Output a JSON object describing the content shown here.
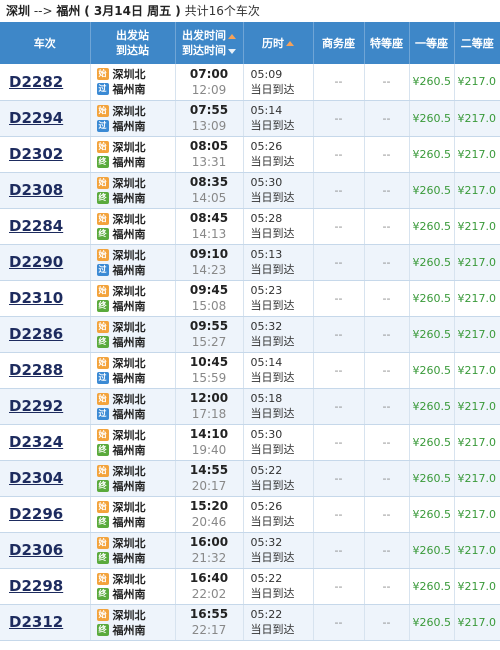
{
  "route": {
    "from": "深圳",
    "arrow": "-->",
    "to": "福州",
    "date": "( 3月14日  周五 )",
    "count": "共计16个车次"
  },
  "headers": {
    "train": "车次",
    "station_from": "出发站",
    "station_to": "到达站",
    "time_dep": "出发时间",
    "time_arr": "到达时间",
    "duration": "历时",
    "business": "商务座",
    "special": "特等座",
    "first": "一等座",
    "second": "二等座"
  },
  "badges": {
    "start": "始",
    "pass": "过",
    "end": "终"
  },
  "rows": [
    {
      "train": "D2282",
      "from": "深圳北",
      "to": "福州南",
      "from_badge": "start",
      "to_badge": "pass",
      "dep": "07:00",
      "arr": "12:09",
      "dur": "05:09",
      "arrive_day": "当日到达",
      "business": "--",
      "special": "--",
      "first": "¥260.5",
      "second": "¥217.0"
    },
    {
      "train": "D2294",
      "from": "深圳北",
      "to": "福州南",
      "from_badge": "start",
      "to_badge": "pass",
      "dep": "07:55",
      "arr": "13:09",
      "dur": "05:14",
      "arrive_day": "当日到达",
      "business": "--",
      "special": "--",
      "first": "¥260.5",
      "second": "¥217.0"
    },
    {
      "train": "D2302",
      "from": "深圳北",
      "to": "福州南",
      "from_badge": "start",
      "to_badge": "end",
      "dep": "08:05",
      "arr": "13:31",
      "dur": "05:26",
      "arrive_day": "当日到达",
      "business": "--",
      "special": "--",
      "first": "¥260.5",
      "second": "¥217.0"
    },
    {
      "train": "D2308",
      "from": "深圳北",
      "to": "福州南",
      "from_badge": "start",
      "to_badge": "end",
      "dep": "08:35",
      "arr": "14:05",
      "dur": "05:30",
      "arrive_day": "当日到达",
      "business": "--",
      "special": "--",
      "first": "¥260.5",
      "second": "¥217.0"
    },
    {
      "train": "D2284",
      "from": "深圳北",
      "to": "福州南",
      "from_badge": "start",
      "to_badge": "end",
      "dep": "08:45",
      "arr": "14:13",
      "dur": "05:28",
      "arrive_day": "当日到达",
      "business": "--",
      "special": "--",
      "first": "¥260.5",
      "second": "¥217.0"
    },
    {
      "train": "D2290",
      "from": "深圳北",
      "to": "福州南",
      "from_badge": "start",
      "to_badge": "pass",
      "dep": "09:10",
      "arr": "14:23",
      "dur": "05:13",
      "arrive_day": "当日到达",
      "business": "--",
      "special": "--",
      "first": "¥260.5",
      "second": "¥217.0"
    },
    {
      "train": "D2310",
      "from": "深圳北",
      "to": "福州南",
      "from_badge": "start",
      "to_badge": "end",
      "dep": "09:45",
      "arr": "15:08",
      "dur": "05:23",
      "arrive_day": "当日到达",
      "business": "--",
      "special": "--",
      "first": "¥260.5",
      "second": "¥217.0"
    },
    {
      "train": "D2286",
      "from": "深圳北",
      "to": "福州南",
      "from_badge": "start",
      "to_badge": "end",
      "dep": "09:55",
      "arr": "15:27",
      "dur": "05:32",
      "arrive_day": "当日到达",
      "business": "--",
      "special": "--",
      "first": "¥260.5",
      "second": "¥217.0"
    },
    {
      "train": "D2288",
      "from": "深圳北",
      "to": "福州南",
      "from_badge": "start",
      "to_badge": "pass",
      "dep": "10:45",
      "arr": "15:59",
      "dur": "05:14",
      "arrive_day": "当日到达",
      "business": "--",
      "special": "--",
      "first": "¥260.5",
      "second": "¥217.0"
    },
    {
      "train": "D2292",
      "from": "深圳北",
      "to": "福州南",
      "from_badge": "start",
      "to_badge": "pass",
      "dep": "12:00",
      "arr": "17:18",
      "dur": "05:18",
      "arrive_day": "当日到达",
      "business": "--",
      "special": "--",
      "first": "¥260.5",
      "second": "¥217.0"
    },
    {
      "train": "D2324",
      "from": "深圳北",
      "to": "福州南",
      "from_badge": "start",
      "to_badge": "end",
      "dep": "14:10",
      "arr": "19:40",
      "dur": "05:30",
      "arrive_day": "当日到达",
      "business": "--",
      "special": "--",
      "first": "¥260.5",
      "second": "¥217.0"
    },
    {
      "train": "D2304",
      "from": "深圳北",
      "to": "福州南",
      "from_badge": "start",
      "to_badge": "end",
      "dep": "14:55",
      "arr": "20:17",
      "dur": "05:22",
      "arrive_day": "当日到达",
      "business": "--",
      "special": "--",
      "first": "¥260.5",
      "second": "¥217.0"
    },
    {
      "train": "D2296",
      "from": "深圳北",
      "to": "福州南",
      "from_badge": "start",
      "to_badge": "end",
      "dep": "15:20",
      "arr": "20:46",
      "dur": "05:26",
      "arrive_day": "当日到达",
      "business": "--",
      "special": "--",
      "first": "¥260.5",
      "second": "¥217.0"
    },
    {
      "train": "D2306",
      "from": "深圳北",
      "to": "福州南",
      "from_badge": "start",
      "to_badge": "end",
      "dep": "16:00",
      "arr": "21:32",
      "dur": "05:32",
      "arrive_day": "当日到达",
      "business": "--",
      "special": "--",
      "first": "¥260.5",
      "second": "¥217.0"
    },
    {
      "train": "D2298",
      "from": "深圳北",
      "to": "福州南",
      "from_badge": "start",
      "to_badge": "end",
      "dep": "16:40",
      "arr": "22:02",
      "dur": "05:22",
      "arrive_day": "当日到达",
      "business": "--",
      "special": "--",
      "first": "¥260.5",
      "second": "¥217.0"
    },
    {
      "train": "D2312",
      "from": "深圳北",
      "to": "福州南",
      "from_badge": "start",
      "to_badge": "end",
      "dep": "16:55",
      "arr": "22:17",
      "dur": "05:22",
      "arrive_day": "当日到达",
      "business": "--",
      "special": "--",
      "first": "¥260.5",
      "second": "¥217.0"
    }
  ]
}
